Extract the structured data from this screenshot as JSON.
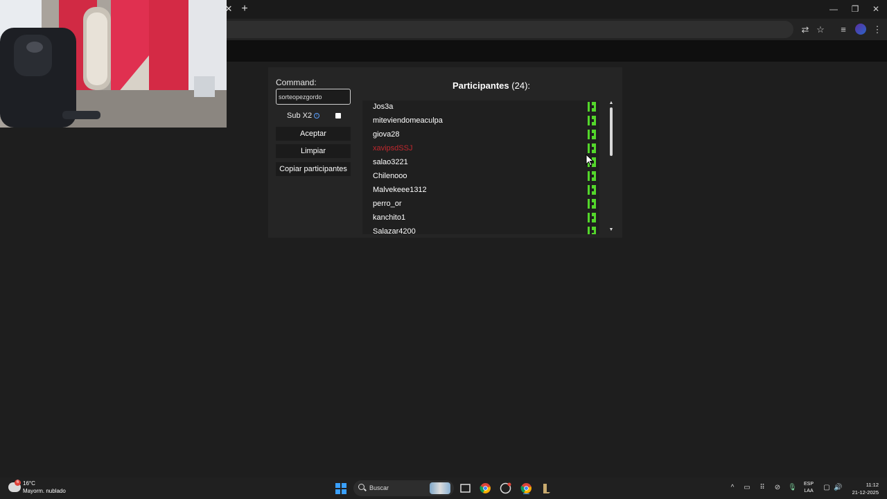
{
  "browser": {
    "close_tab": "✕",
    "new_tab": "+",
    "minimize": "—",
    "restore": "❐",
    "close_window": "✕"
  },
  "panel": {
    "command_label": "Command:",
    "command_value": "sorteopezgordo",
    "sub_label": "Sub X2",
    "sub_checked": false,
    "accept_label": "Aceptar",
    "clear_label": "Limpiar",
    "copy_label": "Copiar participantes",
    "participants_title": "Participantes",
    "participants_count": "(24):"
  },
  "participants": [
    {
      "name": "Jos3a",
      "color": "#ffffff"
    },
    {
      "name": "miteviendomeaculpa",
      "color": "#ffffff"
    },
    {
      "name": "giova28",
      "color": "#ffffff"
    },
    {
      "name": "xavipsdSSJ",
      "color": "#c0282e"
    },
    {
      "name": "salao3221",
      "color": "#ffffff"
    },
    {
      "name": "Chilenooo",
      "color": "#ffffff"
    },
    {
      "name": "Malvekeee1312",
      "color": "#ffffff"
    },
    {
      "name": "perro_or",
      "color": "#ffffff"
    },
    {
      "name": "kanchito1",
      "color": "#ffffff"
    },
    {
      "name": "Salazar4200",
      "color": "#ffffff"
    }
  ],
  "taskbar": {
    "temperature": "16°C",
    "weather": "Mayorm. nublado",
    "weather_badge": "6",
    "search_label": "Buscar",
    "lang_line1": "ESP",
    "lang_line2": "LAA",
    "time": "11:12",
    "date": "21-12-2025"
  },
  "colors": {
    "kick_green": "#53d62b",
    "accent_blue": "#3aa0ff"
  }
}
